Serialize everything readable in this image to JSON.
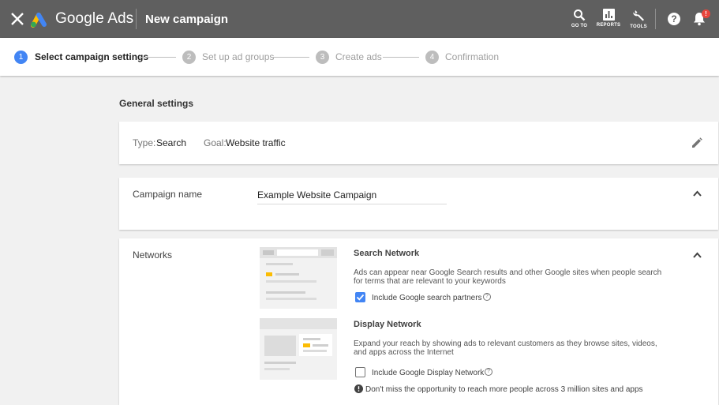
{
  "header": {
    "brand": "Google Ads",
    "title": "New campaign",
    "tools": [
      {
        "icon": "search-icon",
        "label": "GO TO"
      },
      {
        "icon": "reports-icon",
        "label": "REPORTS"
      },
      {
        "icon": "wrench-icon",
        "label": "TOOLS"
      }
    ],
    "help_glyph": "?",
    "notification_badge": "!"
  },
  "stepper": {
    "steps": [
      {
        "number": "1",
        "label": "Select campaign settings",
        "active": true
      },
      {
        "number": "2",
        "label": "Set up ad groups",
        "active": false
      },
      {
        "number": "3",
        "label": "Create ads",
        "active": false
      },
      {
        "number": "4",
        "label": "Confirmation",
        "active": false
      }
    ]
  },
  "general": {
    "section_title": "General settings",
    "type_label": "Type:",
    "type_value": "Search",
    "goal_label": "Goal:",
    "goal_value": "Website traffic"
  },
  "campaign_name": {
    "label": "Campaign name",
    "value": "Example Website Campaign"
  },
  "networks": {
    "label": "Networks",
    "search": {
      "title": "Search Network",
      "description": "Ads can appear near Google Search results and other Google sites when people search for terms that are relevant to your keywords",
      "checkbox_label": "Include Google search partners",
      "checked": true
    },
    "display": {
      "title": "Display Network",
      "description": "Expand your reach by showing ads to relevant customers as they browse sites, videos, and apps across the Internet",
      "checkbox_label": "Include Google Display Network",
      "checked": false,
      "warning": "Don't miss the opportunity to reach more people across 3 million sites and apps"
    }
  },
  "colors": {
    "topbar": "#5f5f5f",
    "accent_blue": "#4285f4",
    "inactive_step": "#bdbdbd",
    "badge_red": "#e8453c",
    "ad_yellow": "#fbbc04"
  }
}
